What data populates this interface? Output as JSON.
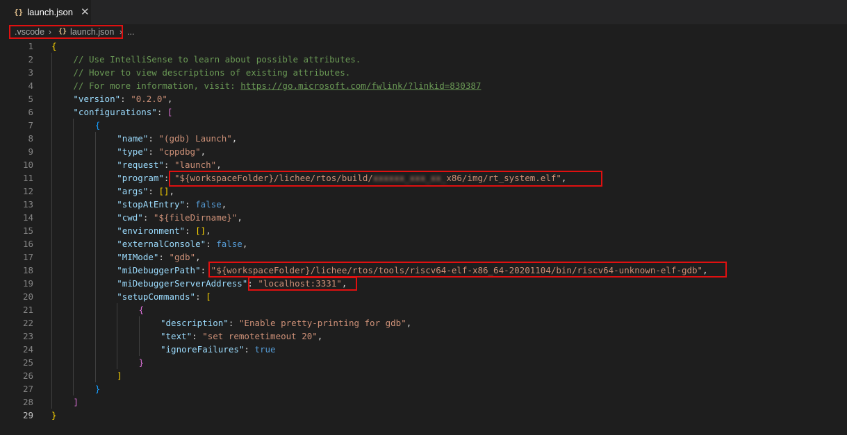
{
  "tab": {
    "icon": "{}",
    "title": "launch.json",
    "close": "✕"
  },
  "breadcrumb": {
    "folder": ".vscode",
    "file_icon": "{}",
    "file": "launch.json",
    "more": "..."
  },
  "editor": {
    "active_line": 29,
    "lines": [
      {
        "n": "1",
        "parts": [
          [
            "br1",
            "{"
          ]
        ]
      },
      {
        "n": "2",
        "parts": [
          [
            "c",
            "// Use IntelliSense to learn about possible attributes."
          ]
        ]
      },
      {
        "n": "3",
        "parts": [
          [
            "c",
            "// Hover to view descriptions of existing attributes."
          ]
        ]
      },
      {
        "n": "4",
        "parts": [
          [
            "c",
            "// For more information, visit: "
          ],
          [
            "c u",
            "https://go.microsoft.com/fwlink/?linkid=830387"
          ]
        ]
      },
      {
        "n": "5",
        "parts": [
          [
            "k",
            "\"version\""
          ],
          [
            "p",
            ": "
          ],
          [
            "s",
            "\"0.2.0\""
          ],
          [
            "p",
            ","
          ]
        ]
      },
      {
        "n": "6",
        "parts": [
          [
            "k",
            "\"configurations\""
          ],
          [
            "p",
            ": "
          ],
          [
            "br2",
            "["
          ]
        ]
      },
      {
        "n": "7",
        "parts": [
          [
            "br3",
            "{"
          ]
        ]
      },
      {
        "n": "8",
        "parts": [
          [
            "k",
            "\"name\""
          ],
          [
            "p",
            ": "
          ],
          [
            "s",
            "\"(gdb) Launch\""
          ],
          [
            "p",
            ","
          ]
        ]
      },
      {
        "n": "9",
        "parts": [
          [
            "k",
            "\"type\""
          ],
          [
            "p",
            ": "
          ],
          [
            "s",
            "\"cppdbg\""
          ],
          [
            "p",
            ","
          ]
        ]
      },
      {
        "n": "10",
        "parts": [
          [
            "k",
            "\"request\""
          ],
          [
            "p",
            ": "
          ],
          [
            "s",
            "\"launch\""
          ],
          [
            "p",
            ","
          ]
        ]
      },
      {
        "n": "11",
        "parts": [
          [
            "k",
            "\"program\""
          ],
          [
            "p",
            ": "
          ],
          [
            "s",
            "\"${workspaceFolder}/lichee/rtos/build/"
          ],
          [
            "s blur",
            "xxxxxx_xxx_xx_"
          ],
          [
            "s",
            "x86/img/rt_system.elf\""
          ],
          [
            "p",
            ","
          ]
        ]
      },
      {
        "n": "12",
        "parts": [
          [
            "k",
            "\"args\""
          ],
          [
            "p",
            ": "
          ],
          [
            "br1",
            "[]"
          ],
          [
            "p",
            ","
          ]
        ]
      },
      {
        "n": "13",
        "parts": [
          [
            "k",
            "\"stopAtEntry\""
          ],
          [
            "p",
            ": "
          ],
          [
            "b",
            "false"
          ],
          [
            "p",
            ","
          ]
        ]
      },
      {
        "n": "14",
        "parts": [
          [
            "k",
            "\"cwd\""
          ],
          [
            "p",
            ": "
          ],
          [
            "s",
            "\"${fileDirname}\""
          ],
          [
            "p",
            ","
          ]
        ]
      },
      {
        "n": "15",
        "parts": [
          [
            "k",
            "\"environment\""
          ],
          [
            "p",
            ": "
          ],
          [
            "br1",
            "[]"
          ],
          [
            "p",
            ","
          ]
        ]
      },
      {
        "n": "16",
        "parts": [
          [
            "k",
            "\"externalConsole\""
          ],
          [
            "p",
            ": "
          ],
          [
            "b",
            "false"
          ],
          [
            "p",
            ","
          ]
        ]
      },
      {
        "n": "17",
        "parts": [
          [
            "k",
            "\"MIMode\""
          ],
          [
            "p",
            ": "
          ],
          [
            "s",
            "\"gdb\""
          ],
          [
            "p",
            ","
          ]
        ]
      },
      {
        "n": "18",
        "parts": [
          [
            "k",
            "\"miDebuggerPath\""
          ],
          [
            "p",
            ": "
          ],
          [
            "s",
            "\"${workspaceFolder}/lichee/rtos/tools/riscv64-elf-x86_64-20201104/bin/riscv64-unknown-elf-gdb\""
          ],
          [
            "p",
            ","
          ]
        ]
      },
      {
        "n": "19",
        "parts": [
          [
            "k",
            "\"miDebuggerServerAddress\""
          ],
          [
            "p",
            ": "
          ],
          [
            "s",
            "\"localhost:3331\""
          ],
          [
            "p",
            ","
          ]
        ]
      },
      {
        "n": "20",
        "parts": [
          [
            "k",
            "\"setupCommands\""
          ],
          [
            "p",
            ": "
          ],
          [
            "br1",
            "["
          ]
        ]
      },
      {
        "n": "21",
        "parts": [
          [
            "br2",
            "{"
          ]
        ]
      },
      {
        "n": "22",
        "parts": [
          [
            "k",
            "\"description\""
          ],
          [
            "p",
            ": "
          ],
          [
            "s",
            "\"Enable pretty-printing for gdb\""
          ],
          [
            "p",
            ","
          ]
        ]
      },
      {
        "n": "23",
        "parts": [
          [
            "k",
            "\"text\""
          ],
          [
            "p",
            ": "
          ],
          [
            "s",
            "\"set remotetimeout 20\""
          ],
          [
            "p",
            ","
          ]
        ]
      },
      {
        "n": "24",
        "parts": [
          [
            "k",
            "\"ignoreFailures\""
          ],
          [
            "p",
            ": "
          ],
          [
            "b",
            "true"
          ]
        ]
      },
      {
        "n": "25",
        "parts": [
          [
            "br2",
            "}"
          ]
        ]
      },
      {
        "n": "26",
        "parts": [
          [
            "br1",
            "]"
          ]
        ]
      },
      {
        "n": "27",
        "parts": [
          [
            "br3",
            "}"
          ]
        ]
      },
      {
        "n": "28",
        "parts": [
          [
            "br2",
            "]"
          ]
        ]
      },
      {
        "n": "29",
        "parts": [
          [
            "br1",
            "}"
          ]
        ]
      }
    ]
  },
  "colors": {
    "background": "#1e1e1e",
    "key": "#9cdcfe",
    "string": "#ce9178",
    "comment": "#6a9955",
    "keyword": "#569cd6",
    "highlight_box": "#e01010"
  }
}
